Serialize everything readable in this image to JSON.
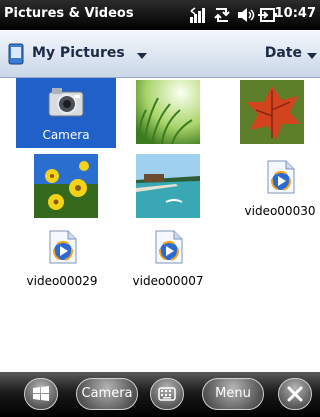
{
  "title_bar": {
    "title": "Pictures & Videos",
    "status_icons": [
      "signal-icon",
      "sync-icon",
      "speaker-icon",
      "battery-charging-icon"
    ],
    "clock": "10:47"
  },
  "folder_bar": {
    "folder_label": "My Pictures",
    "sort_label": "Date"
  },
  "items": [
    {
      "kind": "folder",
      "label": "Camera",
      "selected": true,
      "icon": "camera-icon"
    },
    {
      "kind": "photo",
      "label": "",
      "subject": "grass"
    },
    {
      "kind": "photo",
      "label": "",
      "subject": "autumn-leaf"
    },
    {
      "kind": "photo",
      "label": "",
      "subject": "yellow-flowers"
    },
    {
      "kind": "photo",
      "label": "",
      "subject": "beach-pier"
    },
    {
      "kind": "video",
      "label": "video00030",
      "icon": "video-file-icon"
    },
    {
      "kind": "video",
      "label": "video00029",
      "icon": "video-file-icon"
    },
    {
      "kind": "video",
      "label": "video00007",
      "icon": "video-file-icon"
    }
  ],
  "bottom_bar": {
    "start_icon": "windows-start-icon",
    "camera_label": "Camera",
    "keyboard_icon": "keyboard-icon",
    "menu_label": "Menu",
    "close_icon": "close-icon"
  },
  "colors": {
    "selection": "#1f61c9",
    "title_bar": "#000000",
    "folder_bar": "#c9d7e8",
    "bottom_bar": "#1a1a1a"
  }
}
